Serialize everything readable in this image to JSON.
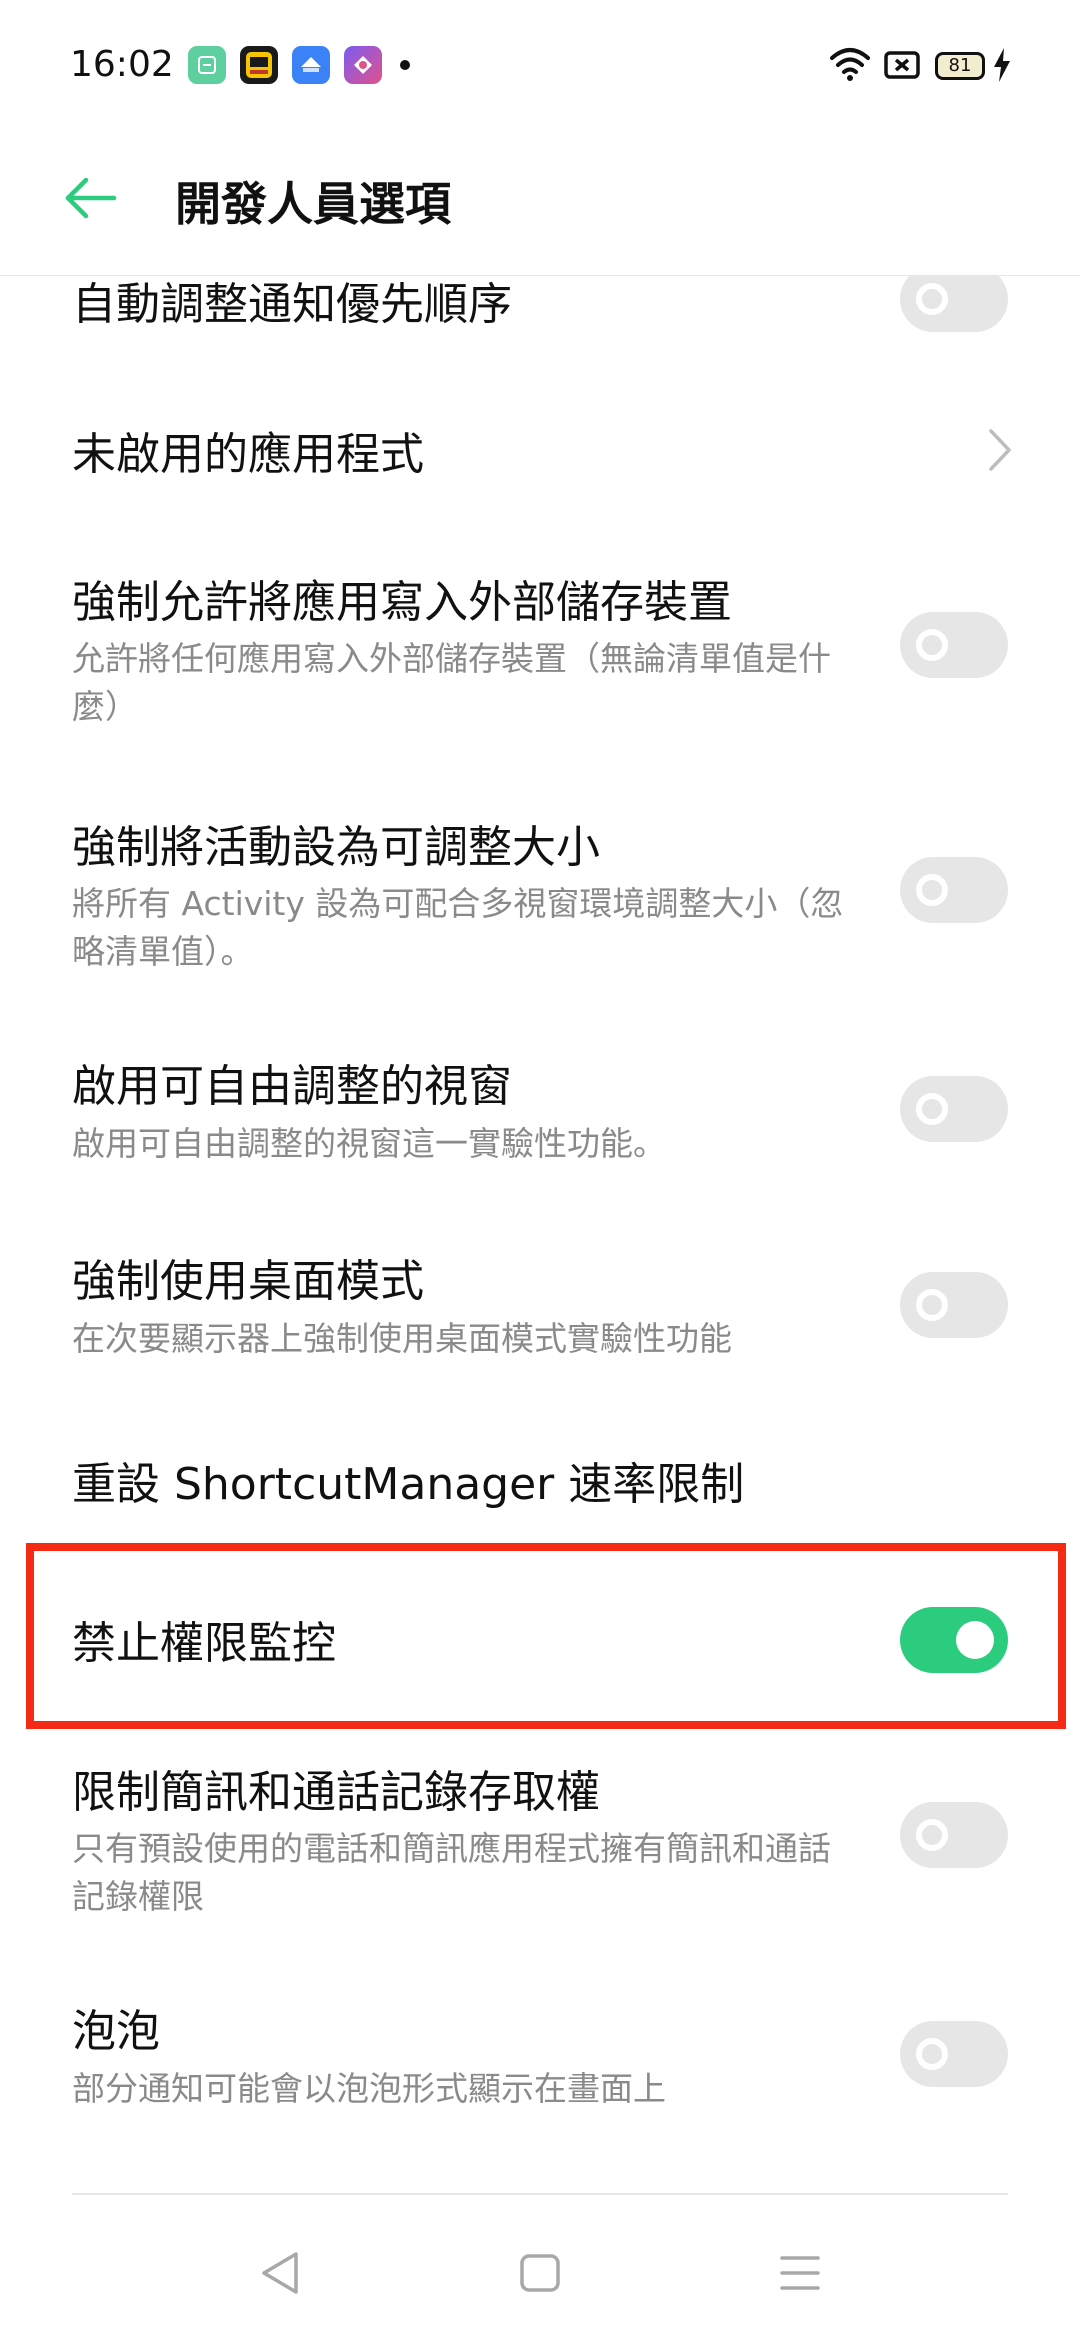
{
  "status_bar": {
    "time": "16:02",
    "battery": "81",
    "icons": [
      "app-icon-green",
      "app-icon-sohu",
      "app-icon-blue",
      "app-icon-purple",
      "wifi-icon",
      "sim-x-icon",
      "battery-icon",
      "charging-icon"
    ]
  },
  "header": {
    "title": "開發人員選項"
  },
  "items": [
    {
      "title": "自動調整通知優先順序",
      "type": "toggle",
      "on": false
    },
    {
      "title": "未啟用的應用程式",
      "type": "link"
    },
    {
      "title": "強制允許將應用寫入外部儲存裝置",
      "subtitle": "允許將任何應用寫入外部儲存裝置（無論清單值是什麼）",
      "type": "toggle",
      "on": false
    },
    {
      "title": "強制將活動設為可調整大小",
      "subtitle": "將所有 Activity 設為可配合多視窗環境調整大小（忽略清單值）。",
      "type": "toggle",
      "on": false
    },
    {
      "title": "啟用可自由調整的視窗",
      "subtitle": "啟用可自由調整的視窗這一實驗性功能。",
      "type": "toggle",
      "on": false
    },
    {
      "title": "強制使用桌面模式",
      "subtitle": "在次要顯示器上強制使用桌面模式實驗性功能",
      "type": "toggle",
      "on": false
    },
    {
      "title": "重設 ShortcutManager 速率限制",
      "type": "action"
    },
    {
      "title": "禁止權限監控",
      "type": "toggle",
      "on": true
    },
    {
      "title": "限制簡訊和通話記錄存取權",
      "subtitle": "只有預設使用的電話和簡訊應用程式擁有簡訊和通話記錄權限",
      "type": "toggle",
      "on": false
    },
    {
      "title": "泡泡",
      "subtitle": "部分通知可能會以泡泡形式顯示在畫面上",
      "type": "toggle",
      "on": false
    }
  ],
  "colors": {
    "accent": "#2bcc7e",
    "highlight": "#f52a14",
    "subtitle": "#8a8a8a"
  }
}
